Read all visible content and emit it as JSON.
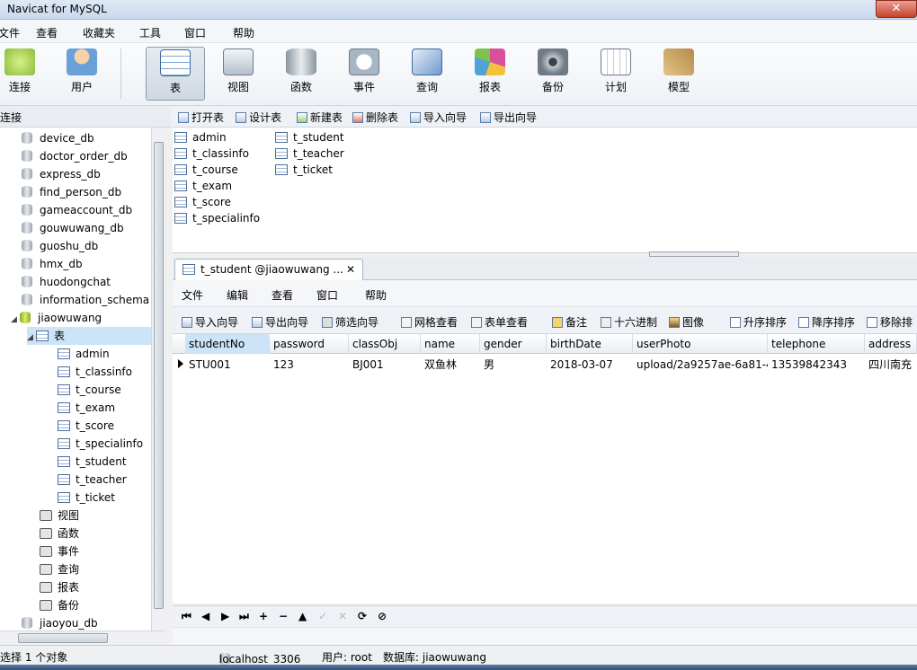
{
  "window": {
    "title": "Navicat for MySQL",
    "close_glyph": "✕"
  },
  "menu": [
    "文件",
    "查看",
    "收藏夹",
    "工具",
    "窗口",
    "帮助"
  ],
  "toolbar": [
    {
      "label": "连接",
      "icon": "connection-icon",
      "color": "#8bbd3a"
    },
    {
      "label": "用户",
      "icon": "user-icon",
      "color": "#e0a46c"
    },
    {
      "label": "表",
      "icon": "table-icon",
      "color": "#4f8ac9"
    },
    {
      "label": "视图",
      "icon": "view-icon",
      "color": "#8a9aab"
    },
    {
      "label": "函数",
      "icon": "function-icon",
      "color": "#c7a44a"
    },
    {
      "label": "事件",
      "icon": "event-icon",
      "color": "#9aa8b6"
    },
    {
      "label": "查询",
      "icon": "query-icon",
      "color": "#5c8ac0"
    },
    {
      "label": "报表",
      "icon": "report-icon",
      "color": "#c77ab8"
    },
    {
      "label": "备份",
      "icon": "backup-icon",
      "color": "#6f7a85"
    },
    {
      "label": "计划",
      "icon": "schedule-icon",
      "color": "#8a9aab"
    },
    {
      "label": "模型",
      "icon": "model-icon",
      "color": "#b58a4a"
    }
  ],
  "left_header": "连接",
  "object_toolbar": [
    "打开表",
    "设计表",
    "新建表",
    "删除表",
    "导入向导",
    "导出向导"
  ],
  "tree": {
    "databases_top": [
      "device_db",
      "doctor_order_db",
      "express_db",
      "find_person_db",
      "gameaccount_db",
      "gouwuwang_db",
      "guoshu_db",
      "hmx_db",
      "huodongchat",
      "information_schema"
    ],
    "open_db": "jiaowuwang",
    "tables_group": "表",
    "tables": [
      "admin",
      "t_classinfo",
      "t_course",
      "t_exam",
      "t_score",
      "t_specialinfo",
      "t_student",
      "t_teacher",
      "t_ticket"
    ],
    "groups": [
      "视图",
      "函数",
      "事件",
      "查询",
      "报表",
      "备份"
    ],
    "databases_bottom": [
      "jiaoyou_db"
    ]
  },
  "objects": {
    "col1": [
      "admin",
      "t_classinfo",
      "t_course",
      "t_exam",
      "t_score",
      "t_specialinfo"
    ],
    "col2": [
      "t_student",
      "t_teacher",
      "t_ticket"
    ]
  },
  "editor_tab": {
    "label": "t_student @jiaowuwang ...",
    "close": "✕"
  },
  "inner_menu": [
    "文件",
    "编辑",
    "查看",
    "窗口",
    "帮助"
  ],
  "inner_toolbar": [
    "导入向导",
    "导出向导",
    "筛选向导",
    "网格查看",
    "表单查看",
    "备注",
    "十六进制",
    "图像",
    "升序排序",
    "降序排序",
    "移除排"
  ],
  "grid": {
    "columns": [
      "studentNo",
      "password",
      "classObj",
      "name",
      "gender",
      "birthDate",
      "userPhoto",
      "telephone",
      "address"
    ],
    "rows": [
      [
        "STU001",
        "123",
        "BJ001",
        "双鱼林",
        "男",
        "2018-03-07",
        "upload/2a9257ae-6a81-4",
        "13539842343",
        "四川南充"
      ]
    ]
  },
  "navbar": [
    "⏮",
    "◀",
    "▶",
    "⏭",
    "+",
    "−",
    "▲",
    "✓",
    "✕",
    "⟳",
    "⊘"
  ],
  "status": {
    "selection": "选择 1 个对象",
    "server": "localhost_3306",
    "user": "用户: root",
    "database": "数据库: jiaowuwang"
  }
}
